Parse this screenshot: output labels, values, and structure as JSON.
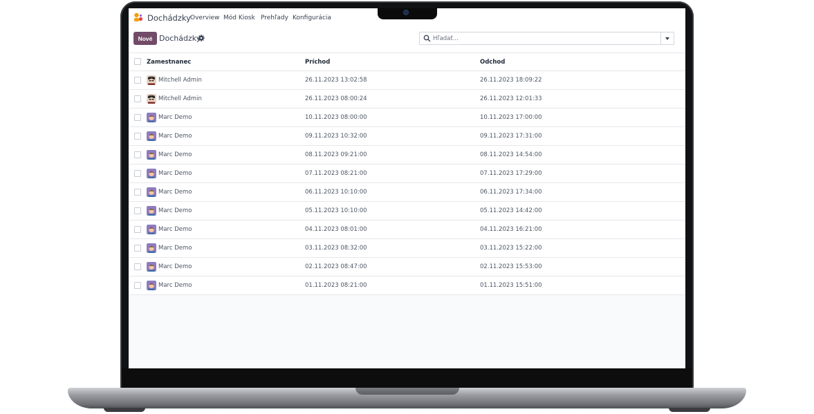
{
  "app": {
    "name": "Dochádzky"
  },
  "menu": [
    "Overview",
    "Mód Kiosk",
    "Prehľady",
    "Konfigurácia"
  ],
  "toolbar": {
    "new_label": "Nové",
    "breadcrumb": "Dochádzky"
  },
  "search": {
    "placeholder": "Hľadať..."
  },
  "table": {
    "columns": [
      "Zamestnanec",
      "Príchod",
      "Odchod"
    ],
    "rows": [
      {
        "employee": "Mitchell Admin",
        "avatar": "admin",
        "check_in": "26.11.2023 13:02:58",
        "check_out": "26.11.2023 18:09:22"
      },
      {
        "employee": "Mitchell Admin",
        "avatar": "admin",
        "check_in": "26.11.2023 08:00:24",
        "check_out": "26.11.2023 12:01:33"
      },
      {
        "employee": "Marc Demo",
        "avatar": "demo",
        "check_in": "10.11.2023 08:00:00",
        "check_out": "10.11.2023 17:00:00"
      },
      {
        "employee": "Marc Demo",
        "avatar": "demo",
        "check_in": "09.11.2023 10:32:00",
        "check_out": "09.11.2023 17:31:00"
      },
      {
        "employee": "Marc Demo",
        "avatar": "demo",
        "check_in": "08.11.2023 09:21:00",
        "check_out": "08.11.2023 14:54:00"
      },
      {
        "employee": "Marc Demo",
        "avatar": "demo",
        "check_in": "07.11.2023 08:21:00",
        "check_out": "07.11.2023 17:29:00"
      },
      {
        "employee": "Marc Demo",
        "avatar": "demo",
        "check_in": "06.11.2023 10:10:00",
        "check_out": "06.11.2023 17:34:00"
      },
      {
        "employee": "Marc Demo",
        "avatar": "demo",
        "check_in": "05.11.2023 10:10:00",
        "check_out": "05.11.2023 14:42:00"
      },
      {
        "employee": "Marc Demo",
        "avatar": "demo",
        "check_in": "04.11.2023 08:01:00",
        "check_out": "04.11.2023 16:21:00"
      },
      {
        "employee": "Marc Demo",
        "avatar": "demo",
        "check_in": "03.11.2023 08:32:00",
        "check_out": "03.11.2023 15:22:00"
      },
      {
        "employee": "Marc Demo",
        "avatar": "demo",
        "check_in": "02.11.2023 08:47:00",
        "check_out": "02.11.2023 15:53:00"
      },
      {
        "employee": "Marc Demo",
        "avatar": "demo",
        "check_in": "01.11.2023 08:21:00",
        "check_out": "01.11.2023 15:51:00"
      }
    ]
  },
  "colors": {
    "brand": "#714b67",
    "text": "#374151",
    "border": "#e5e7eb",
    "background": "#f9fafb"
  },
  "icons": {
    "logo": "attendance-logo-icon",
    "settings": "gear-icon",
    "search": "search-icon",
    "toggle": "caret-down-icon"
  }
}
